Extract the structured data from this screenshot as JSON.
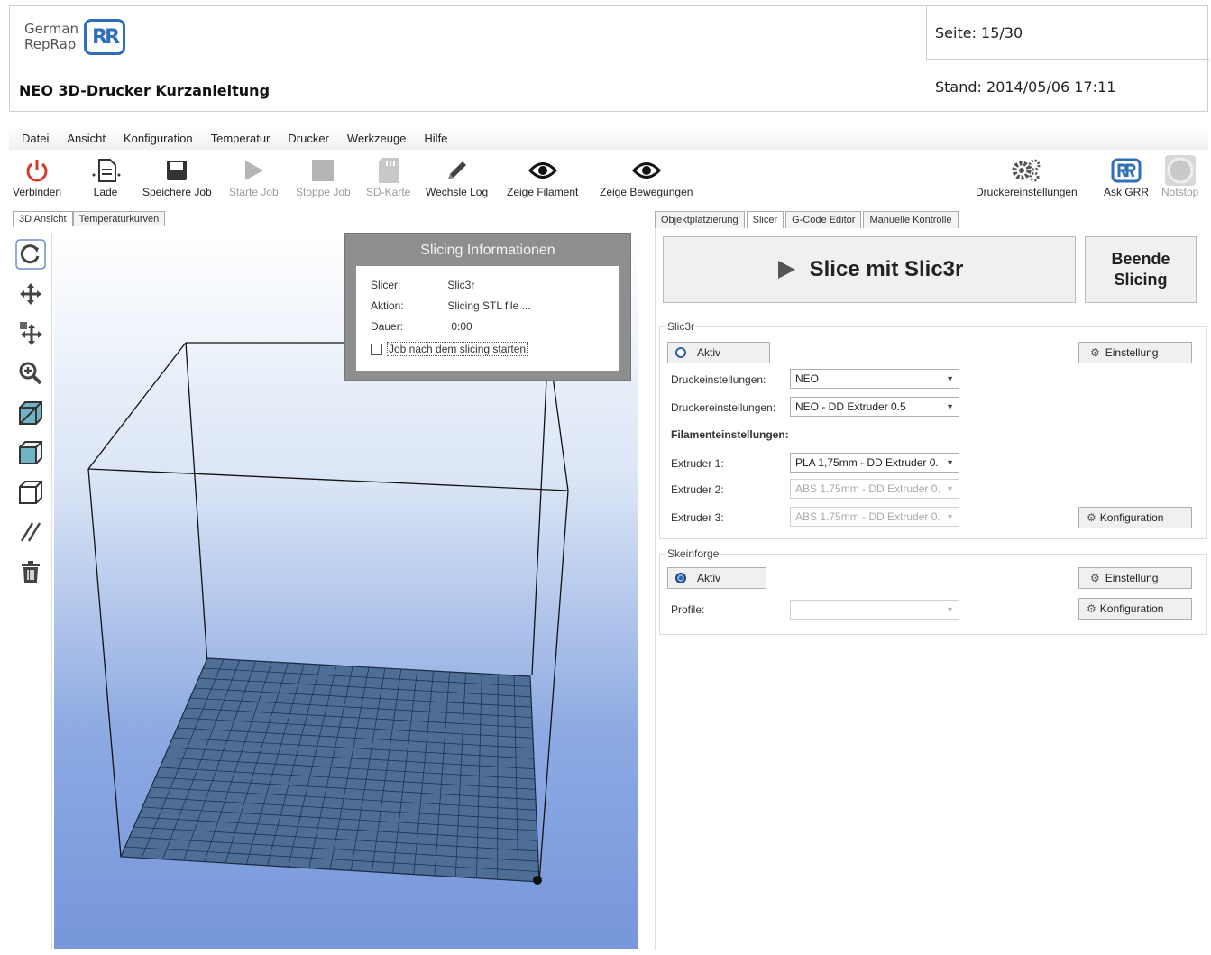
{
  "doc": {
    "logo_line1": "German",
    "logo_line2": "RepRap",
    "logo_mark": "RR",
    "title": "NEO 3D-Drucker Kurzanleitung",
    "page": "Seite: 15/30",
    "stand": "Stand: 2014/05/06 17:11"
  },
  "menu": [
    "Datei",
    "Ansicht",
    "Konfiguration",
    "Temperatur",
    "Drucker",
    "Werkzeuge",
    "Hilfe"
  ],
  "toolbar": {
    "connect": "Verbinden",
    "load": "Lade",
    "save_job": "Speichere Job",
    "start_job": "Starte Job",
    "stop_job": "Stoppe Job",
    "sd_card": "SD-Karte",
    "toggle_log": "Wechsle Log",
    "show_filament": "Zeige Filament",
    "show_moves": "Zeige Bewegungen",
    "printer_settings": "Druckereinstellungen",
    "ask_grr": "Ask GRR",
    "emergency": "Notstop"
  },
  "left_tabs": [
    "3D Ansicht",
    "Temperaturkurven"
  ],
  "slicing_info": {
    "title": "Slicing Informationen",
    "slicer_label": "Slicer:",
    "slicer_value": "Slic3r",
    "action_label": "Aktion:",
    "action_value": "Slicing STL file ...",
    "duration_label": "Dauer:",
    "duration_value": "0:00",
    "start_after": "Job nach dem slicing starten"
  },
  "right_tabs": [
    "Objektplatzierung",
    "Slicer",
    "G-Code Editor",
    "Manuelle Kontrolle"
  ],
  "slicer": {
    "slice_button": "Slice mit Slic3r",
    "stop_line1": "Beende",
    "stop_line2": "Slicing",
    "slic3r_group": "Slic3r",
    "active": "Aktiv",
    "settings_btn": "Einstellung",
    "print_settings_label": "Druckeinstellungen:",
    "print_settings_value": "NEO",
    "printer_settings_label": "Druckereinstellungen:",
    "printer_settings_value": "NEO - DD Extruder 0.5",
    "filament_header": "Filamenteinstellungen:",
    "extruder1_label": "Extruder 1:",
    "extruder1_value": "PLA 1,75mm - DD Extruder 0.",
    "extruder2_label": "Extruder 2:",
    "extruder2_value": "ABS 1.75mm - DD Extruder 0.",
    "extruder3_label": "Extruder 3:",
    "extruder3_value": "ABS 1.75mm - DD Extruder 0.",
    "config_btn": "Konfiguration",
    "skeinforge_group": "Skeinforge",
    "profile_label": "Profile:",
    "profile_value": ""
  },
  "colors": {
    "accent": "#2f6fb7",
    "power_red": "#d23a2a",
    "bed": "#4f6e96",
    "viewport_bottom": "#7797dc"
  }
}
